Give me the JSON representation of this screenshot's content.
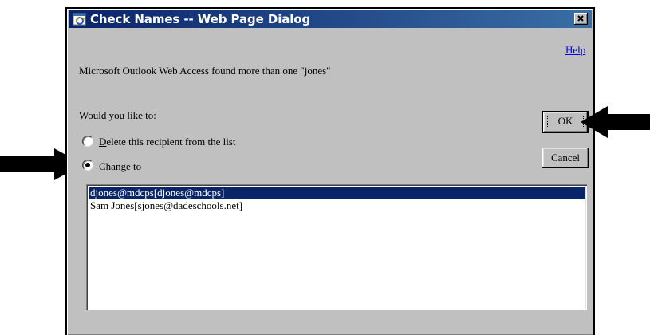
{
  "dialog": {
    "title": "Check Names -- Web Page Dialog",
    "help_label": "Help",
    "message": "Microsoft Outlook Web Access found more than one \"jones\"",
    "prompt": "Would you like to:",
    "options": [
      {
        "label_accel": "D",
        "label_rest": "elete this recipient from the list",
        "selected": false
      },
      {
        "label_accel": "C",
        "label_rest": "hange to",
        "selected": true
      }
    ],
    "buttons": {
      "ok": "OK",
      "cancel": "Cancel"
    },
    "matches": [
      {
        "text": "djones@mdcps[djones@mdcps]",
        "selected": true
      },
      {
        "text": "Sam Jones[sjones@dadeschools.net]",
        "selected": false
      }
    ]
  },
  "colors": {
    "title_bar": "#0a246a",
    "dialog_face": "#c0c0c0",
    "selection": "#0a246a",
    "link": "#0000ee"
  },
  "icons": {
    "title": "ie-icon",
    "close": "close-icon",
    "annotations": "arrow-icon"
  }
}
